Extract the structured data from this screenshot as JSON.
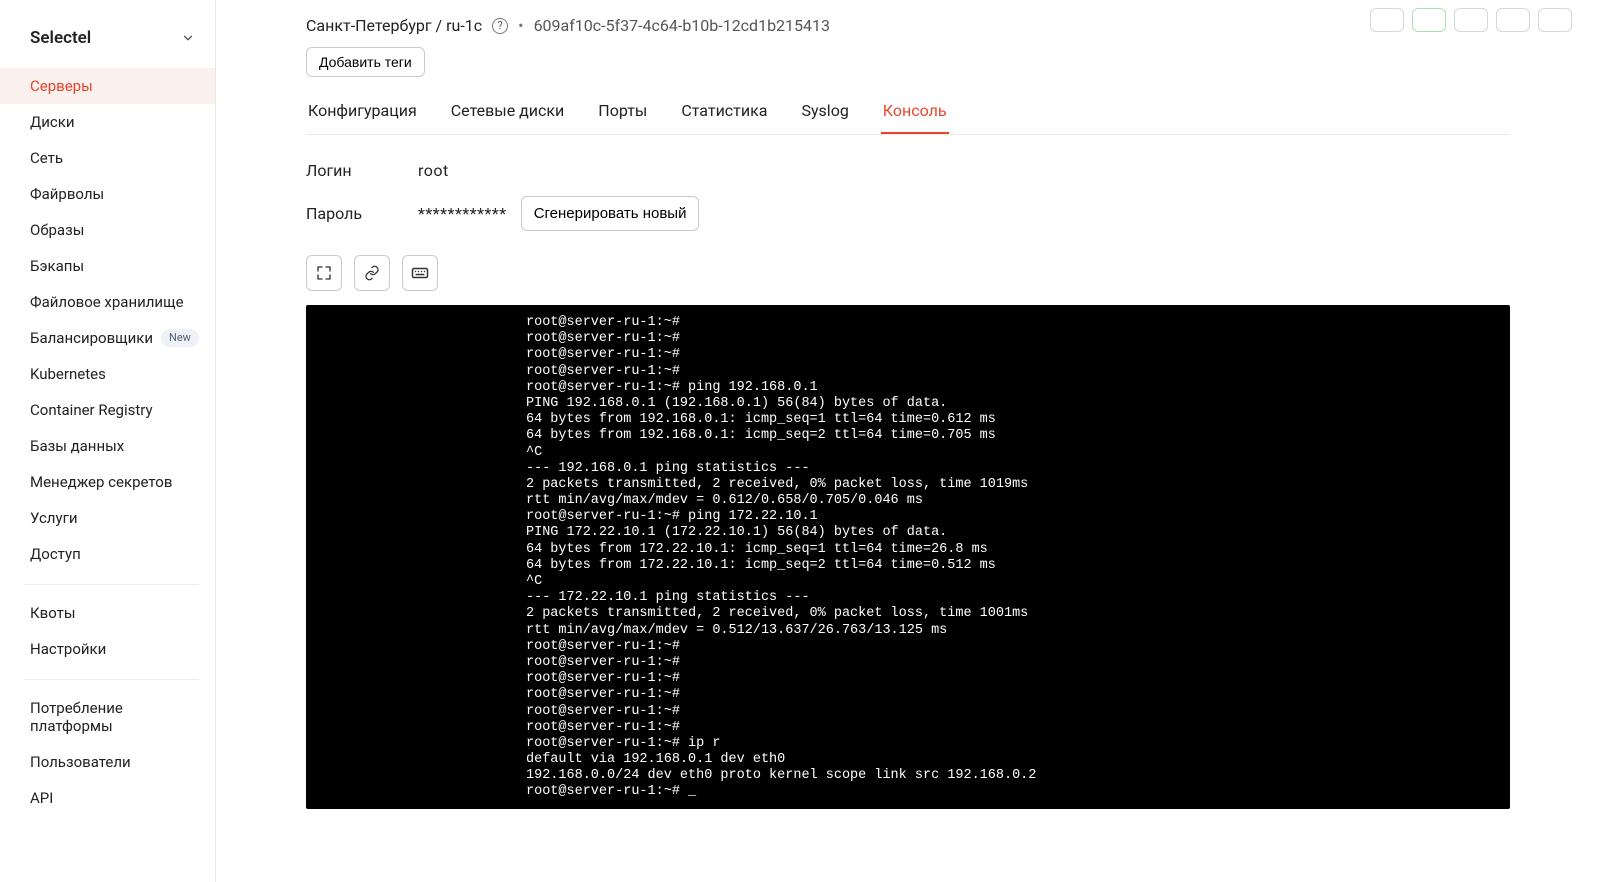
{
  "brand": {
    "name": "Selectel"
  },
  "sidebar": {
    "groups": [
      {
        "items": [
          {
            "label": "Серверы",
            "name": "sidebar-item-servers",
            "active": true
          },
          {
            "label": "Диски",
            "name": "sidebar-item-disks"
          },
          {
            "label": "Сеть",
            "name": "sidebar-item-network"
          },
          {
            "label": "Файрволы",
            "name": "sidebar-item-firewalls"
          },
          {
            "label": "Образы",
            "name": "sidebar-item-images"
          },
          {
            "label": "Бэкапы",
            "name": "sidebar-item-backups"
          },
          {
            "label": "Файловое хранилище",
            "name": "sidebar-item-file-storage"
          },
          {
            "label": "Балансировщики",
            "name": "sidebar-item-balancers",
            "badge": "New"
          },
          {
            "label": "Kubernetes",
            "name": "sidebar-item-kubernetes"
          },
          {
            "label": "Container Registry",
            "name": "sidebar-item-container-registry"
          },
          {
            "label": "Базы данных",
            "name": "sidebar-item-databases"
          },
          {
            "label": "Менеджер секретов",
            "name": "sidebar-item-secrets"
          },
          {
            "label": "Услуги",
            "name": "sidebar-item-services"
          },
          {
            "label": "Доступ",
            "name": "sidebar-item-access"
          }
        ]
      },
      {
        "items": [
          {
            "label": "Квоты",
            "name": "sidebar-item-quotas"
          },
          {
            "label": "Настройки",
            "name": "sidebar-item-settings"
          }
        ]
      },
      {
        "items": [
          {
            "label": "Потребление платформы",
            "name": "sidebar-item-usage"
          },
          {
            "label": "Пользователи",
            "name": "sidebar-item-users"
          },
          {
            "label": "API",
            "name": "sidebar-item-api"
          }
        ]
      }
    ]
  },
  "header": {
    "location": "Санкт-Петербург / ru-1c",
    "uuid": "609af10c-5f37-4c64-b10b-12cd1b215413",
    "add_tags_label": "Добавить теги"
  },
  "tabs": [
    {
      "label": "Конфигурация",
      "name": "tab-configuration"
    },
    {
      "label": "Сетевые диски",
      "name": "tab-network-disks"
    },
    {
      "label": "Порты",
      "name": "tab-ports"
    },
    {
      "label": "Статистика",
      "name": "tab-stats"
    },
    {
      "label": "Syslog",
      "name": "tab-syslog"
    },
    {
      "label": "Консоль",
      "name": "tab-console",
      "active": true
    }
  ],
  "creds": {
    "login_label": "Логин",
    "login_value": "root",
    "password_label": "Пароль",
    "password_value": "************",
    "regen_label": "Сгенерировать новый"
  },
  "console_text": "root@server-ru-1:~#\nroot@server-ru-1:~#\nroot@server-ru-1:~#\nroot@server-ru-1:~#\nroot@server-ru-1:~# ping 192.168.0.1\nPING 192.168.0.1 (192.168.0.1) 56(84) bytes of data.\n64 bytes from 192.168.0.1: icmp_seq=1 ttl=64 time=0.612 ms\n64 bytes from 192.168.0.1: icmp_seq=2 ttl=64 time=0.705 ms\n^C\n--- 192.168.0.1 ping statistics ---\n2 packets transmitted, 2 received, 0% packet loss, time 1019ms\nrtt min/avg/max/mdev = 0.612/0.658/0.705/0.046 ms\nroot@server-ru-1:~# ping 172.22.10.1\nPING 172.22.10.1 (172.22.10.1) 56(84) bytes of data.\n64 bytes from 172.22.10.1: icmp_seq=1 ttl=64 time=26.8 ms\n64 bytes from 172.22.10.1: icmp_seq=2 ttl=64 time=0.512 ms\n^C\n--- 172.22.10.1 ping statistics ---\n2 packets transmitted, 2 received, 0% packet loss, time 1001ms\nrtt min/avg/max/mdev = 0.512/13.637/26.763/13.125 ms\nroot@server-ru-1:~#\nroot@server-ru-1:~#\nroot@server-ru-1:~#\nroot@server-ru-1:~#\nroot@server-ru-1:~#\nroot@server-ru-1:~#\nroot@server-ru-1:~# ip r\ndefault via 192.168.0.1 dev eth0\n192.168.0.0/24 dev eth0 proto kernel scope link src 192.168.0.2\nroot@server-ru-1:~# _"
}
